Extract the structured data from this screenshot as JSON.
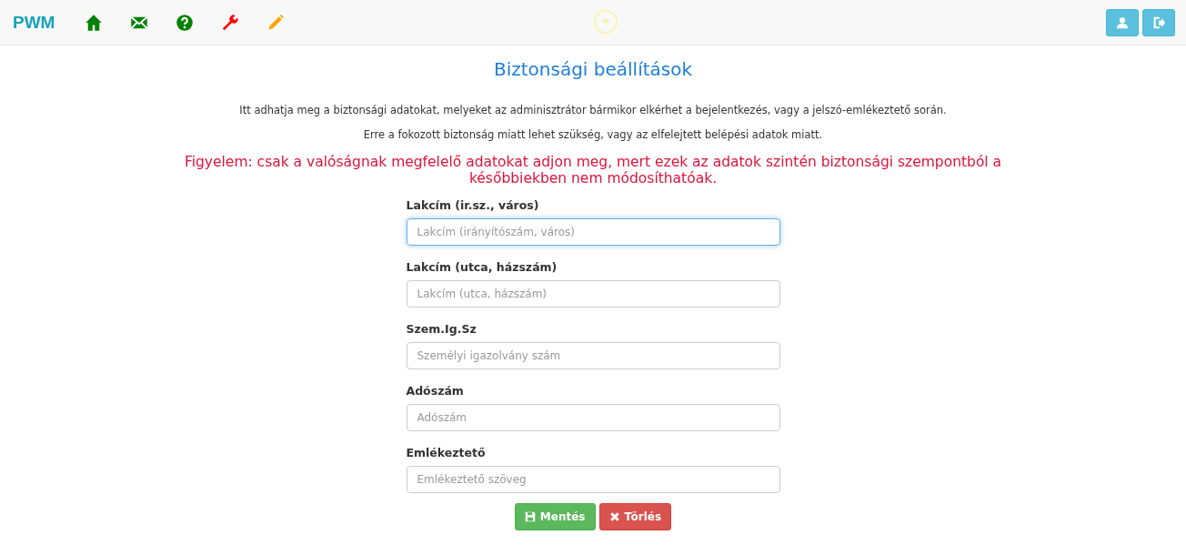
{
  "navbar": {
    "brand": "PWM",
    "icons": [
      {
        "kind": "home",
        "color": "#008000"
      },
      {
        "kind": "mail",
        "color": "#008000"
      },
      {
        "kind": "help",
        "color": "#008000"
      },
      {
        "kind": "wrench",
        "color": "#ff0000"
      },
      {
        "kind": "pencil",
        "color": "#ffa500"
      }
    ],
    "right_buttons": [
      {
        "kind": "user"
      },
      {
        "kind": "logout"
      }
    ]
  },
  "title": "Biztonsági beállítások",
  "paragraphs": [
    "Itt adhatja meg a biztonsági adatokat, melyeket az adminisztrátor bármikor elkérhet a bejelentkezés, vagy a jelszó-emlékeztető során.",
    "Erre a fokozott biztonság miatt lehet szükség, vagy az elfelejtett belépési adatok miatt."
  ],
  "warning": "Figyelem: csak a valóságnak megfelelő adatokat adjon meg, mert ezek az adatok szintén biztonsági szempontból a későbbiekben nem módosíthatóak.",
  "fields": [
    {
      "label": "Lakcím (ir.sz., város)",
      "placeholder": "Lakcím (irányítószám, város)",
      "focused": true
    },
    {
      "label": "Lakcím (utca, házszám)",
      "placeholder": "Lakcím (utca, házszám)",
      "focused": false
    },
    {
      "label": "Szem.Ig.Sz",
      "placeholder": "Személyi igazolvány szám",
      "focused": false
    },
    {
      "label": "Adószám",
      "placeholder": "Adószám",
      "focused": false
    },
    {
      "label": "Emlékeztető",
      "placeholder": "Emlékeztető szöveg",
      "focused": false
    }
  ],
  "buttons": [
    {
      "kind": "save",
      "label": "Mentés"
    },
    {
      "kind": "delete",
      "label": "Törlés"
    }
  ]
}
